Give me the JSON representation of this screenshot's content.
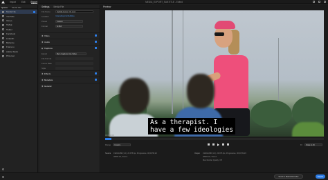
{
  "titlebar": {
    "nav": [
      "Import",
      "Edit",
      "Export"
    ],
    "active_nav": "Export",
    "project_title": "MEDIA_EXPORT_SUBTITLE - Edited"
  },
  "source": {
    "tabs": [
      "Queue",
      "Media File"
    ],
    "items": [
      {
        "label": "Media File",
        "selected": true,
        "checked": true
      },
      {
        "label": "YouTube",
        "selected": false,
        "checked": false
      },
      {
        "label": "Vimeo",
        "selected": false,
        "checked": false
      },
      {
        "label": "TikTok",
        "selected": false,
        "checked": false
      },
      {
        "label": "Twitter",
        "selected": false,
        "checked": false
      },
      {
        "label": "Facebook",
        "selected": false,
        "checked": false
      },
      {
        "label": "LinkedIn",
        "selected": false,
        "checked": false
      },
      {
        "label": "Behance",
        "selected": false,
        "checked": false
      },
      {
        "label": "Frame.io",
        "selected": false,
        "checked": false
      },
      {
        "label": "Adobe Stock",
        "selected": false,
        "checked": false
      },
      {
        "label": "Pinterest",
        "selected": false,
        "checked": false
      }
    ]
  },
  "settings": {
    "title": "Settings",
    "tab": "Media File",
    "file_name_label": "File Name",
    "file_name_value": "Subtitle Export_01.mp4",
    "location_label": "Location",
    "location_value": "/Users/Exports/Subtitles",
    "preset_label": "Preset",
    "preset_value": "Custom",
    "format_label": "Format",
    "format_value": "H.264",
    "sections": [
      {
        "label": "Video",
        "checked": true
      },
      {
        "label": "Audio",
        "checked": true
      },
      {
        "label": "Captions",
        "checked": true
      },
      {
        "label": "Effects",
        "checked": false
      },
      {
        "label": "Metadata",
        "checked": false
      },
      {
        "label": "General",
        "checked": false
      }
    ],
    "captions_export_label": "Export",
    "captions_export_value": "Burn Captions Into Video",
    "captions_format_label": "File Format",
    "captions_frame_label": "Frame Rate",
    "captions_style_label": "Style"
  },
  "preview": {
    "title": "Preview",
    "subtitle_line1": "As a therapist. I",
    "subtitle_line2": "have a few ideologies",
    "timecode_in": "00;00;00;00",
    "timecode_out": "00;00;59;23",
    "progress": 0.03,
    "range_label": "Range",
    "range_value": "Custom",
    "fit_label": "Fit",
    "fit_value": "Scale to Fit"
  },
  "info": {
    "source_label": "Source",
    "source_lines": [
      "1920x1080 (1.0), 23.976 fps, Progressive, 00;00;59;23",
      "48000 Hz, Stereo"
    ],
    "output_label": "Output",
    "output_lines": [
      "1920x1080 (1.0), 23.976 fps, Progressive, 00;00;59;23",
      "48000 Hz, Stereo"
    ],
    "right_labels": [
      "Estimated File Size:",
      "Bitrate: VBR, 1 pass, Target 10 Mbps",
      "Max Render Quality: Off"
    ]
  },
  "statusbar": {
    "media_encoder_label": "Send to Media Encoder",
    "export_label": "Export"
  },
  "colors": {
    "accent": "#2d7de6",
    "shirt": "#ee4f7b"
  }
}
